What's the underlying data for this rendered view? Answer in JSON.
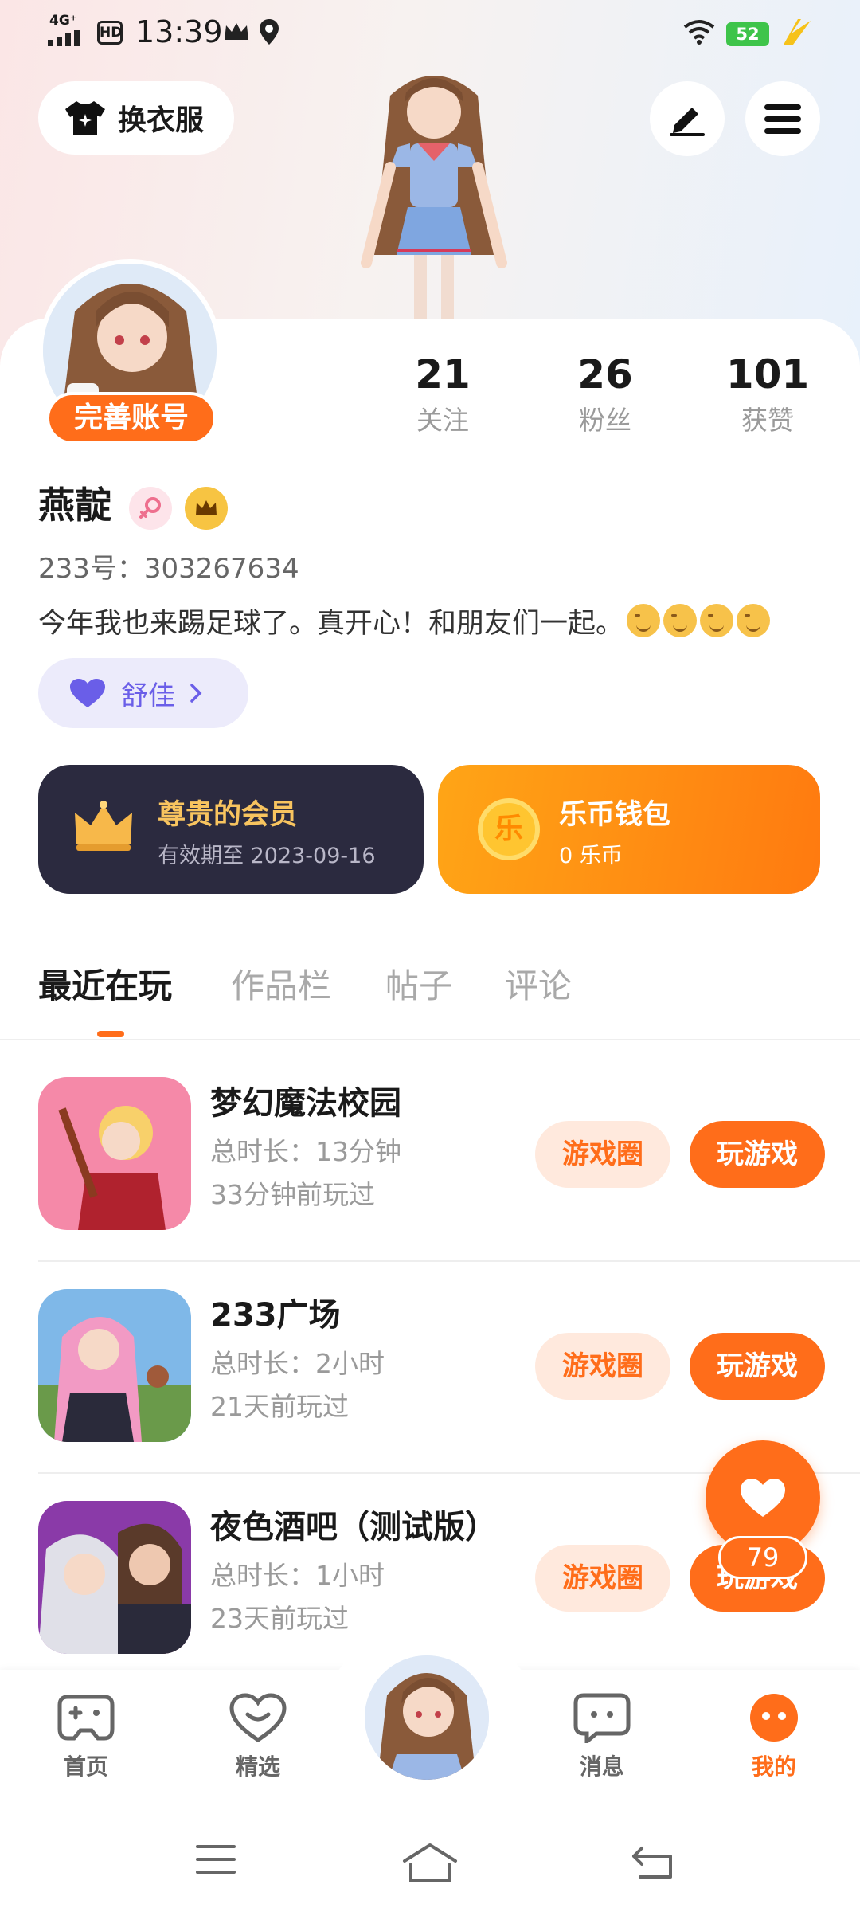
{
  "status_bar": {
    "network": "4G⁺",
    "hd": "HD",
    "time": "13:39",
    "battery": "52"
  },
  "header": {
    "outfit_label": "换衣服",
    "edit_icon": "pen-icon",
    "menu_icon": "menu-icon"
  },
  "profile": {
    "complete_account_label": "完善账号",
    "stats": [
      {
        "value": "21",
        "label": "关注"
      },
      {
        "value": "26",
        "label": "粉丝"
      },
      {
        "value": "101",
        "label": "获赞"
      }
    ],
    "name": "燕靛",
    "uid": "233号：303267634",
    "bio": "今年我也来踢足球了。真开心！和朋友们一起。",
    "bio_emoji_count": 4,
    "tag_label": "舒佳"
  },
  "membership": {
    "vip_title": "尊贵的会员",
    "vip_subtitle": "有效期至 2023-09-16",
    "wallet_title": "乐币钱包",
    "wallet_subtitle": "0 乐币",
    "coin_char": "乐"
  },
  "tabs": [
    "最近在玩",
    "作品栏",
    "帖子",
    "评论"
  ],
  "games": [
    {
      "title": "梦幻魔法校园",
      "duration": "总时长：13分钟",
      "last_played": "33分钟前玩过",
      "circle_label": "游戏圈",
      "play_label": "玩游戏"
    },
    {
      "title": "233广场",
      "duration": "总时长：2小时",
      "last_played": "21天前玩过",
      "circle_label": "游戏圈",
      "play_label": "玩游戏"
    },
    {
      "title": "夜色酒吧（测试版）",
      "duration": "总时长：1小时",
      "last_played": "23天前玩过",
      "circle_label": "游戏圈",
      "play_label": "玩游戏"
    }
  ],
  "fab": {
    "count": "79"
  },
  "bottom_nav": [
    {
      "label": "首页"
    },
    {
      "label": "精选"
    },
    {
      "label": "消息"
    },
    {
      "label": "我的"
    }
  ],
  "colors": {
    "accent": "#ff6d1a",
    "vip_bg": "#2b2a3f",
    "gold": "#f8c45f"
  }
}
